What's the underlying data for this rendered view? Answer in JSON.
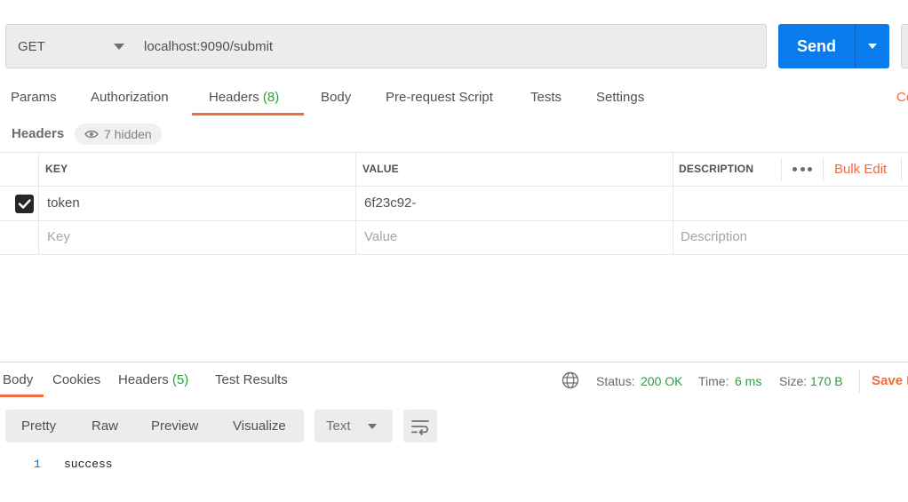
{
  "request": {
    "method": "GET",
    "url": "localhost:9090/submit",
    "send_label": "Send"
  },
  "request_tabs": {
    "params": "Params",
    "authorization": "Authorization",
    "headers": "Headers",
    "headers_count": "(8)",
    "body": "Body",
    "pre_request": "Pre-request Script",
    "tests": "Tests",
    "settings": "Settings",
    "cookies_partial": "Cookies"
  },
  "headers_section": {
    "title": "Headers",
    "hidden_label": "7 hidden"
  },
  "table": {
    "columns": {
      "key": "KEY",
      "value": "VALUE",
      "description": "DESCRIPTION"
    },
    "bulk_edit": "Bulk Edit",
    "rows": [
      {
        "key": "token",
        "value": "6f23c92-",
        "description": "",
        "checked": true
      }
    ],
    "placeholders": {
      "key": "Key",
      "value": "Value",
      "description": "Description"
    }
  },
  "response": {
    "tabs": {
      "body": "Body",
      "cookies": "Cookies",
      "headers": "Headers",
      "headers_count": "(5)",
      "test_results": "Test Results"
    },
    "status_label": "Status:",
    "status_value": "200 OK",
    "time_label": "Time:",
    "time_value": "6 ms",
    "size_label": "Size:",
    "size_value": "170 B",
    "save_label": "Save Response",
    "format": {
      "pretty": "Pretty",
      "raw": "Raw",
      "preview": "Preview",
      "visualize": "Visualize",
      "type": "Text"
    },
    "body_lines": [
      {
        "num": "1",
        "text": "success"
      }
    ]
  },
  "colors": {
    "accent": "#f26b3a",
    "send": "#097bed",
    "success": "#26a23c"
  }
}
